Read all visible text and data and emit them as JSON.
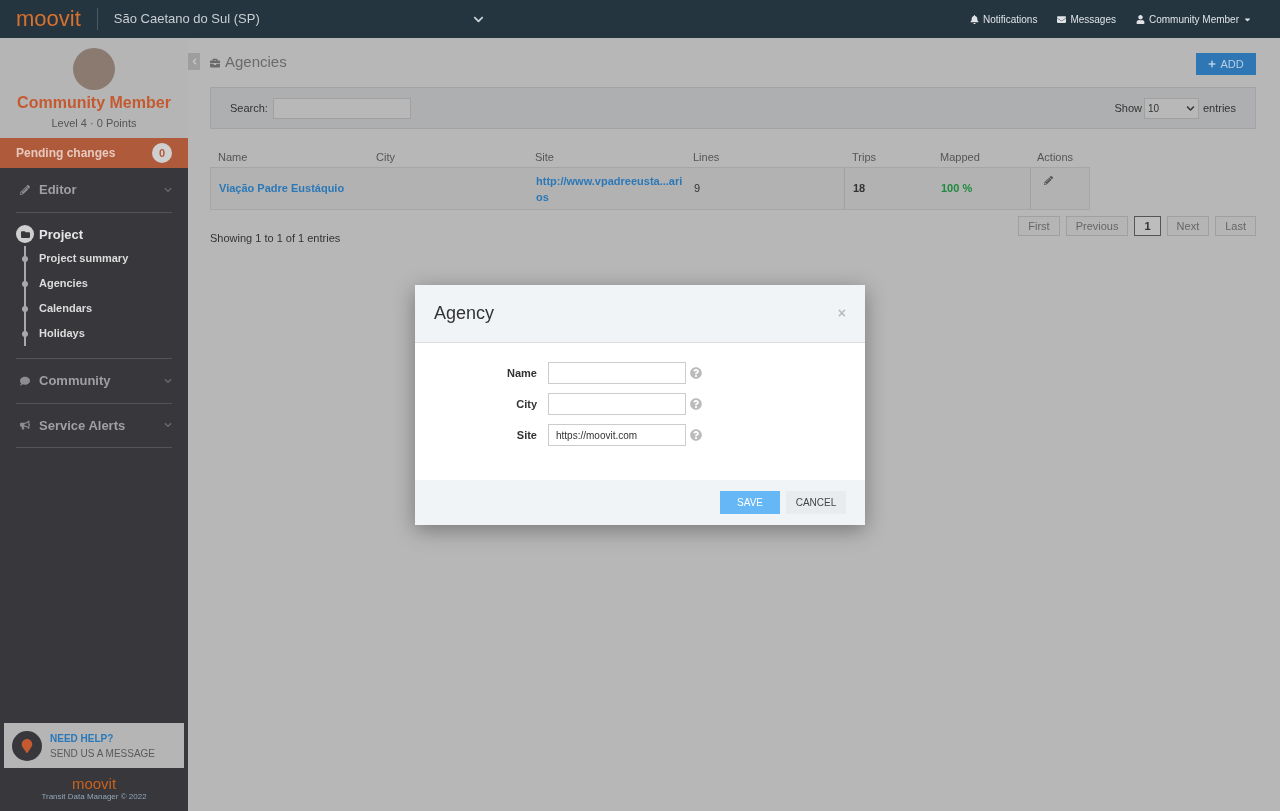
{
  "topbar": {
    "logo": "moovit",
    "region": "São Caetano do Sul (SP)",
    "links": [
      "Notifications",
      "Messages",
      "Community Member"
    ]
  },
  "sidebar": {
    "profile": {
      "name": "Community Member",
      "level": "Level 4 · 0 Points"
    },
    "pending": {
      "label": "Pending changes",
      "count": "0"
    },
    "sections": [
      {
        "label": "Editor",
        "expanded": false
      },
      {
        "label": "Project",
        "expanded": true,
        "children": [
          {
            "label": "Project summary"
          },
          {
            "label": "Agencies"
          },
          {
            "label": "Calendars"
          },
          {
            "label": "Holidays"
          }
        ]
      },
      {
        "label": "Community",
        "expanded": false
      },
      {
        "label": "Service Alerts",
        "expanded": false
      }
    ],
    "help": {
      "title": "NEED HELP?",
      "subtitle": "SEND US A MESSAGE"
    },
    "footer": {
      "logo": "moovit",
      "caption": "Transit Data Manager © 2022"
    }
  },
  "page": {
    "title": "Agencies",
    "add_button": "ADD",
    "search_label": "Search:",
    "show_label": "Show",
    "page_size": "10",
    "entries_label": "entries",
    "table": {
      "columns": [
        "Name",
        "City",
        "Site",
        "Lines",
        "Trips",
        "Mapped",
        "Actions"
      ],
      "rows": [
        {
          "name": "Viação Padre Eustáquio",
          "site": "http://www.vpadreeusta...arios",
          "lines": "9",
          "trips": "18",
          "mapped": "100 %"
        }
      ]
    },
    "info": "Showing 1 to 1 of 1 entries",
    "pagination": [
      {
        "label": "First",
        "selected": false
      },
      {
        "label": "Previous",
        "selected": false
      },
      {
        "label": "1",
        "selected": true
      },
      {
        "label": "Next",
        "selected": false
      },
      {
        "label": "Last",
        "selected": false
      }
    ]
  },
  "dialog": {
    "title": "Agency",
    "close": "×",
    "fields": [
      {
        "label": "Name"
      },
      {
        "label": "City"
      },
      {
        "label": "Site",
        "value": "https://moovit.com"
      }
    ],
    "buttons": [
      "SAVE",
      "CANCEL"
    ]
  }
}
